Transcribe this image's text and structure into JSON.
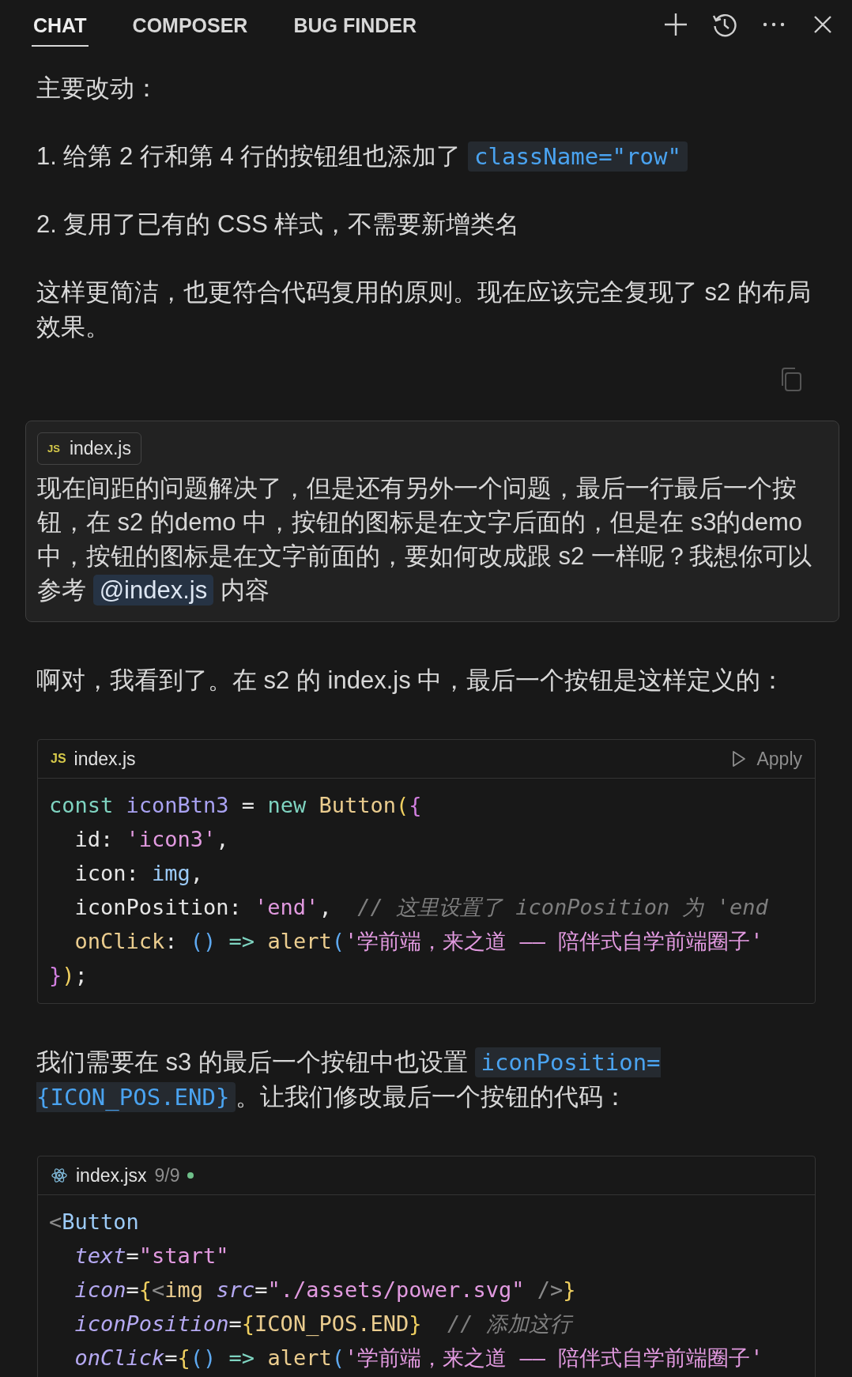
{
  "tabs": [
    {
      "label": "CHAT",
      "selected": true
    },
    {
      "label": "COMPOSER",
      "selected": false
    },
    {
      "label": "BUG FINDER",
      "selected": false
    }
  ],
  "reply_top": {
    "paragraphs": [
      [
        {
          "kind": "text",
          "text": "主要改动："
        }
      ],
      [
        {
          "kind": "text",
          "text": "1. 给第 2 行和第 4 行的按钮组也添加了 "
        },
        {
          "kind": "code",
          "text": "className=\"row\""
        }
      ],
      [
        {
          "kind": "text",
          "text": "2. 复用了已有的 CSS 样式，不需要新增类名"
        }
      ],
      [
        {
          "kind": "text",
          "text": "这样更简洁，也更符合代码复用的原则。现在应该完全复现了 s2 的布局效果。"
        }
      ]
    ]
  },
  "user_message": {
    "attachment": {
      "badge": "JS",
      "name": "index.js"
    },
    "text_before": "现在间距的问题解决了，但是还有另外一个问题，最后一行最后一个按钮，在 s2 的demo 中，按钮的图标是在文字后面的，但是在 s3的demo 中，按钮的图标是在文字前面的，要如何改成跟 s2 一样呢？我想你可以参考 ",
    "mention": "@index.js",
    "text_after": " 内容"
  },
  "reply_bottom": [
    {
      "kind": "paragraph",
      "segments": [
        {
          "kind": "text",
          "text": "啊对，我看到了。在 s2 的 index.js 中，最后一个按钮是这样定义的："
        }
      ]
    },
    {
      "kind": "code_block",
      "file": {
        "kind": "js",
        "badge": "JS",
        "name": "index.js"
      },
      "apply": "Apply",
      "lines": [
        [
          {
            "kind": "kw",
            "text": "const "
          },
          {
            "kind": "var",
            "text": "iconBtn3"
          },
          {
            "kind": "plain",
            "text": " = "
          },
          {
            "kind": "kw",
            "text": "new "
          },
          {
            "kind": "fn",
            "text": "Button"
          },
          {
            "kind": "br1",
            "text": "("
          },
          {
            "kind": "br2",
            "text": "{"
          }
        ],
        [
          {
            "kind": "plain",
            "text": "  id: "
          },
          {
            "kind": "str",
            "text": "'icon3'"
          },
          {
            "kind": "plain",
            "text": ","
          }
        ],
        [
          {
            "kind": "plain",
            "text": "  icon: "
          },
          {
            "kind": "ident",
            "text": "img"
          },
          {
            "kind": "plain",
            "text": ","
          }
        ],
        [
          {
            "kind": "plain",
            "text": "  iconPosition: "
          },
          {
            "kind": "str",
            "text": "'end'"
          },
          {
            "kind": "plain",
            "text": ",  "
          },
          {
            "kind": "comment",
            "text": "// 这里设置了 iconPosition 为 'end"
          }
        ],
        [
          {
            "kind": "fn",
            "text": "  onClick"
          },
          {
            "kind": "plain",
            "text": ": "
          },
          {
            "kind": "br3",
            "text": "()"
          },
          {
            "kind": "kw",
            "text": " => "
          },
          {
            "kind": "fn",
            "text": "alert"
          },
          {
            "kind": "br3",
            "text": "("
          },
          {
            "kind": "str",
            "text": "'学前端，来之道 —— 陪伴式自学前端圈子'"
          }
        ],
        [
          {
            "kind": "br2",
            "text": "}"
          },
          {
            "kind": "br1",
            "text": ")"
          },
          {
            "kind": "plain",
            "text": ";"
          }
        ]
      ]
    },
    {
      "kind": "paragraph",
      "segments": [
        {
          "kind": "text",
          "text": "我们需要在 s3 的最后一个按钮中也设置 "
        },
        {
          "kind": "code",
          "text": "iconPosition={ICON_POS.END}"
        },
        {
          "kind": "text",
          "text": "。让我们修改最后一个按钮的代码："
        }
      ]
    },
    {
      "kind": "code_block",
      "file": {
        "kind": "react",
        "name": "index.jsx"
      },
      "count": "9/9",
      "lines": [
        [
          {
            "kind": "punc",
            "text": "<"
          },
          {
            "kind": "tag",
            "text": "Button"
          }
        ],
        [
          {
            "kind": "attr",
            "text": "  text"
          },
          {
            "kind": "plain",
            "text": "="
          },
          {
            "kind": "str",
            "text": "\"start\""
          }
        ],
        [
          {
            "kind": "attr",
            "text": "  icon"
          },
          {
            "kind": "plain",
            "text": "="
          },
          {
            "kind": "br1",
            "text": "{"
          },
          {
            "kind": "punc",
            "text": "<"
          },
          {
            "kind": "fn",
            "text": "img "
          },
          {
            "kind": "attr",
            "text": "src"
          },
          {
            "kind": "plain",
            "text": "="
          },
          {
            "kind": "str",
            "text": "\"./assets/power.svg\""
          },
          {
            "kind": "punc",
            "text": " />"
          },
          {
            "kind": "br1",
            "text": "}"
          }
        ],
        [
          {
            "kind": "attr",
            "text": "  iconPosition"
          },
          {
            "kind": "plain",
            "text": "="
          },
          {
            "kind": "br1",
            "text": "{"
          },
          {
            "kind": "fn",
            "text": "ICON_POS.END"
          },
          {
            "kind": "br1",
            "text": "}"
          },
          {
            "kind": "comment",
            "text": "  // 添加这行"
          }
        ],
        [
          {
            "kind": "attr",
            "text": "  onClick"
          },
          {
            "kind": "plain",
            "text": "="
          },
          {
            "kind": "br1",
            "text": "{"
          },
          {
            "kind": "br3",
            "text": "()"
          },
          {
            "kind": "kw",
            "text": " => "
          },
          {
            "kind": "fn",
            "text": "alert"
          },
          {
            "kind": "br3",
            "text": "("
          },
          {
            "kind": "str",
            "text": "'学前端，来之道 —— 陪伴式自学前端圈子'"
          }
        ]
      ]
    }
  ]
}
